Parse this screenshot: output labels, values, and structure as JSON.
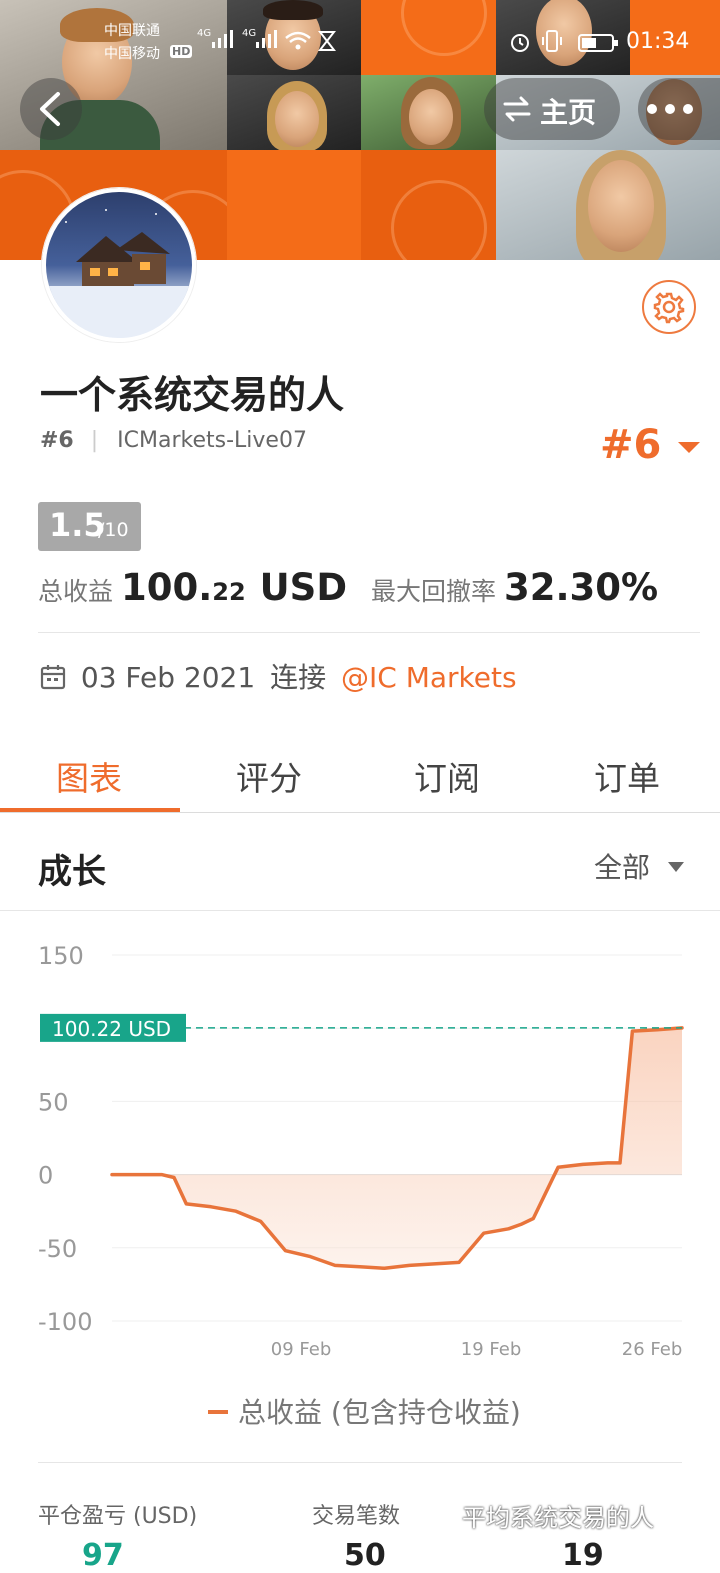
{
  "status_bar": {
    "carrier1": "中国联通",
    "carrier2": "中国移动",
    "hd": "HD",
    "net1": "4G",
    "net2": "4G",
    "time": "01:34"
  },
  "header": {
    "back_icon": "chevron-left-icon",
    "home_label": "主页",
    "swap_icon": "swap-arrows-icon",
    "more_icon": "more-dots-icon"
  },
  "profile": {
    "name": "一个系统交易的人",
    "rank_small": "#6",
    "server": "ICMarkets-Live07",
    "rank_big": "#6",
    "score": "1.5",
    "score_max": "/10",
    "profit_label": "总收益",
    "profit_int": "100.",
    "profit_dec": "22",
    "profit_unit": "USD",
    "drawdown_label": "最大回撤率",
    "drawdown_value": "32.30%",
    "date": "03 Feb 2021",
    "connect_label": "连接",
    "broker": "@IC Markets"
  },
  "tabs": [
    {
      "label": "图表",
      "active": true
    },
    {
      "label": "评分",
      "active": false
    },
    {
      "label": "订阅",
      "active": false
    },
    {
      "label": "订单",
      "active": false
    }
  ],
  "section": {
    "title": "成长",
    "filter": "全部"
  },
  "chart_data": {
    "type": "area",
    "title": "",
    "xlabel": "",
    "ylabel": "",
    "ylim": [
      -100,
      150
    ],
    "yticks": [
      "150",
      "100",
      "50",
      "0",
      "-50",
      "-100"
    ],
    "xticks": [
      "09 Feb",
      "19 Feb",
      "26 Feb"
    ],
    "current_value_label": "100.22 USD",
    "current_value": 100.22,
    "legend_position": "bottom-center",
    "series": [
      {
        "name": "总收益 (包含持仓收益)",
        "color": "#e8743b",
        "x_index": [
          0,
          2,
          4,
          5,
          6,
          8,
          10,
          12,
          14,
          16,
          18,
          20,
          22,
          24,
          26,
          28,
          30,
          32,
          33,
          34,
          36,
          38,
          40,
          41,
          42,
          44,
          46
        ],
        "values": [
          0,
          0,
          0,
          -2,
          -20,
          -22,
          -25,
          -32,
          -52,
          -56,
          -62,
          -63,
          -64,
          -62,
          -61,
          -60,
          -40,
          -37,
          -34,
          -30,
          5,
          7,
          8,
          8,
          98,
          99,
          100.22
        ]
      }
    ]
  },
  "footer": {
    "col1_label": "平仓盈亏 (USD)",
    "col1_value": "97",
    "col2_label": "交易笔数",
    "col2_value": "50",
    "col3_value": "19",
    "watermark": "平均系统交易的人"
  },
  "colors": {
    "accent": "#ef6c2c",
    "teal": "#18a58a",
    "banner": "#f46c18"
  }
}
